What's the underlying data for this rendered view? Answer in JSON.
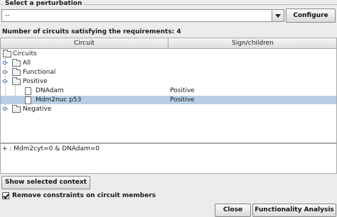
{
  "perturbation": {
    "group_title": "Select a perturbation",
    "selected_value": "--",
    "configure_label": "Configure"
  },
  "count_label": "Number of circuits satisfying the requirements: 4",
  "table": {
    "columns": [
      "Circuit",
      "Sign/children"
    ],
    "rows": [
      {
        "label": "Circuits",
        "sign": ""
      },
      {
        "label": "All",
        "sign": ""
      },
      {
        "label": "Functional",
        "sign": ""
      },
      {
        "label": "Positive",
        "sign": ""
      },
      {
        "label": "DNAdam",
        "sign": "Positive"
      },
      {
        "label": "Mdm2nuc p53",
        "sign": "Positive"
      },
      {
        "label": "Negative",
        "sign": ""
      }
    ]
  },
  "context_text": "+ : Mdm2cyt=0 & DNAdam=0",
  "show_context_label": "Show selected context",
  "remove_constraints": {
    "label": "Remove constraints on circuit members",
    "checked": true
  },
  "footer": {
    "close_label": "Close",
    "functionality_label": "Functionality Analysis"
  },
  "colors": {
    "selection": "#b8cfe5",
    "background": "#ececec"
  },
  "icons": [
    "folder-icon",
    "document-icon",
    "tree-expand-handle-icon",
    "dropdown-arrow-icon",
    "checkmark-icon"
  ]
}
